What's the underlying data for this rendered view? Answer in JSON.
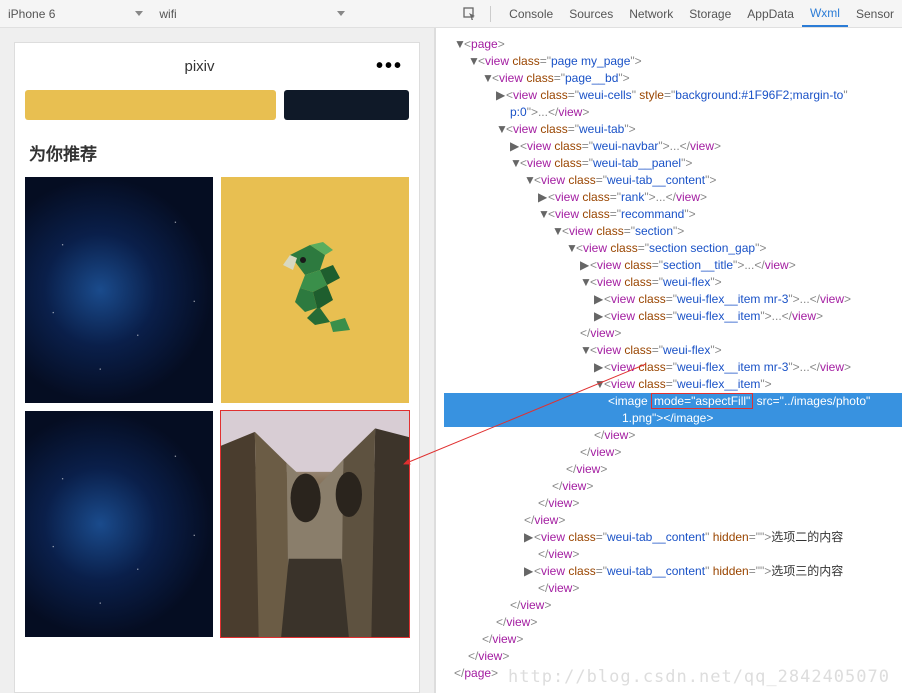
{
  "toolbar": {
    "device": "iPhone 6",
    "network": "wifi",
    "tabs": [
      "Console",
      "Sources",
      "Network",
      "Storage",
      "AppData",
      "Wxml",
      "Sensor"
    ],
    "active_tab": "Wxml"
  },
  "preview": {
    "title": "pixiv",
    "section_title": "为你推荐"
  },
  "dom": {
    "root": "page",
    "lines": [
      {
        "indent": 0,
        "toggle": "▼",
        "open": "page",
        "attrs": []
      },
      {
        "indent": 1,
        "toggle": "▼",
        "open": "view",
        "attrs": [
          {
            "n": "class",
            "v": "page my_page"
          }
        ]
      },
      {
        "indent": 2,
        "toggle": "▼",
        "open": "view",
        "attrs": [
          {
            "n": "class",
            "v": "page__bd"
          }
        ]
      },
      {
        "indent": 3,
        "toggle": "▶",
        "open": "view",
        "attrs": [
          {
            "n": "class",
            "v": "weui-cells"
          },
          {
            "n": "style",
            "v": "background:#1F96F2;margin-to"
          }
        ],
        "wrap": "p:0",
        "close_inline": "view",
        "ellipsis": true
      },
      {
        "indent": 3,
        "toggle": "▼",
        "open": "view",
        "attrs": [
          {
            "n": "class",
            "v": "weui-tab"
          }
        ]
      },
      {
        "indent": 4,
        "toggle": "▶",
        "open": "view",
        "attrs": [
          {
            "n": "class",
            "v": "weui-navbar"
          }
        ],
        "close_inline": "view",
        "ellipsis": true
      },
      {
        "indent": 4,
        "toggle": "▼",
        "open": "view",
        "attrs": [
          {
            "n": "class",
            "v": "weui-tab__panel"
          }
        ]
      },
      {
        "indent": 5,
        "toggle": "▼",
        "open": "view",
        "attrs": [
          {
            "n": "class",
            "v": "weui-tab__content"
          }
        ]
      },
      {
        "indent": 6,
        "toggle": "▶",
        "open": "view",
        "attrs": [
          {
            "n": "class",
            "v": "rank"
          }
        ],
        "close_inline": "view",
        "ellipsis": true
      },
      {
        "indent": 6,
        "toggle": "▼",
        "open": "view",
        "attrs": [
          {
            "n": "class",
            "v": "recommand"
          }
        ]
      },
      {
        "indent": 7,
        "toggle": "▼",
        "open": "view",
        "attrs": [
          {
            "n": "class",
            "v": "section"
          }
        ]
      },
      {
        "indent": 8,
        "toggle": "▼",
        "open": "view",
        "attrs": [
          {
            "n": "class",
            "v": "section section_gap"
          }
        ]
      },
      {
        "indent": 9,
        "toggle": "▶",
        "open": "view",
        "attrs": [
          {
            "n": "class",
            "v": "section__title"
          }
        ],
        "close_inline": "view",
        "ellipsis": true
      },
      {
        "indent": 9,
        "toggle": "▼",
        "open": "view",
        "attrs": [
          {
            "n": "class",
            "v": "weui-flex"
          }
        ]
      },
      {
        "indent": 10,
        "toggle": "▶",
        "open": "view",
        "attrs": [
          {
            "n": "class",
            "v": "weui-flex__item mr-3"
          }
        ],
        "close_inline": "view",
        "ellipsis": true
      },
      {
        "indent": 10,
        "toggle": "▶",
        "open": "view",
        "attrs": [
          {
            "n": "class",
            "v": "weui-flex__item"
          }
        ],
        "close_inline": "view",
        "ellipsis": true
      },
      {
        "indent": 9,
        "close": "view"
      },
      {
        "indent": 9,
        "toggle": "▼",
        "open": "view",
        "attrs": [
          {
            "n": "class",
            "v": "weui-flex"
          }
        ]
      },
      {
        "indent": 10,
        "toggle": "▶",
        "open": "view",
        "attrs": [
          {
            "n": "class",
            "v": "weui-flex__item mr-3"
          }
        ],
        "close_inline": "view",
        "ellipsis": true
      },
      {
        "indent": 10,
        "toggle": "▼",
        "open": "view",
        "attrs": [
          {
            "n": "class",
            "v": "weui-flex__item"
          }
        ]
      },
      {
        "indent": 11,
        "selected": true,
        "open": "image",
        "attrs": [
          {
            "n": "mode",
            "v": "aspectFill",
            "boxed": true
          },
          {
            "n": "src",
            "v": "../images/photo"
          }
        ],
        "wrap_val": "1.png",
        "close_inline": "image"
      },
      {
        "indent": 10,
        "close": "view"
      },
      {
        "indent": 9,
        "close": "view"
      },
      {
        "indent": 8,
        "close": "view"
      },
      {
        "indent": 7,
        "close": "view"
      },
      {
        "indent": 6,
        "close": "view"
      },
      {
        "indent": 5,
        "close": "view"
      },
      {
        "indent": 5,
        "toggle": "▶",
        "open": "view",
        "attrs": [
          {
            "n": "class",
            "v": "weui-tab__content"
          },
          {
            "n": "hidden",
            "v": ""
          }
        ],
        "text": "选项二的内容",
        "close_br": "view"
      },
      {
        "indent": 5,
        "toggle": "▶",
        "open": "view",
        "attrs": [
          {
            "n": "class",
            "v": "weui-tab__content"
          },
          {
            "n": "hidden",
            "v": ""
          }
        ],
        "text": "选项三的内容",
        "close_br": "view"
      },
      {
        "indent": 4,
        "close": "view"
      },
      {
        "indent": 3,
        "close": "view"
      },
      {
        "indent": 2,
        "close": "view"
      },
      {
        "indent": 1,
        "close": "view"
      },
      {
        "indent": 0,
        "close": "page"
      }
    ]
  },
  "watermark": "http://blog.csdn.net/qq_2842405070"
}
